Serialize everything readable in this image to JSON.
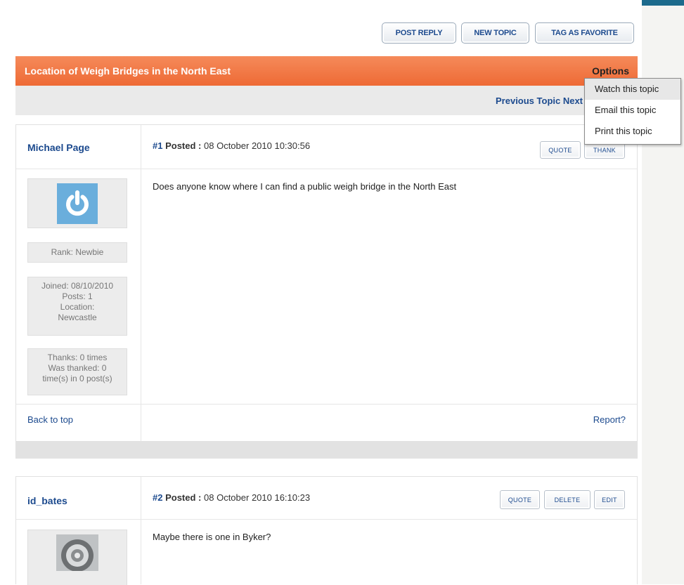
{
  "toolbar": {
    "post_reply": "POST REPLY",
    "new_topic": "NEW TOPIC",
    "tag_favorite": "TAG AS FAVORITE"
  },
  "topic": {
    "title": "Location of Weigh Bridges in the North East",
    "options_label": "Options",
    "prev_next": "Previous Topic Next Topic"
  },
  "options_menu": [
    "Watch this topic",
    "Email this topic",
    "Print this topic"
  ],
  "posts": [
    {
      "author": "Michael Page",
      "number": "#1",
      "posted_label": "Posted :",
      "date": "08 October 2010 10:30:56",
      "message": "Does anyone know where I can find a public weigh bridge in the North East",
      "rank": "Rank: Newbie",
      "joined": "Joined: 08/10/2010",
      "posts": "Posts: 1",
      "location_label": "Location:",
      "location": "Newcastle",
      "thanks": "Thanks: 0 times",
      "was_thanked": "Was thanked: 0",
      "thanked_posts": "time(s) in 0 post(s)",
      "quote": "QUOTE",
      "thank": "THANK",
      "back_to_top": "Back to top",
      "report": "Report?"
    },
    {
      "author": "id_bates",
      "number": "#2",
      "posted_label": "Posted :",
      "date": "08 October 2010 16:10:23",
      "message": "Maybe there is one in Byker?",
      "quote": "QUOTE",
      "delete": "DELETE",
      "edit": "EDIT"
    }
  ],
  "colors": {
    "title_bar": "#ee6a35",
    "link": "#1c4a8e",
    "accent": "#1c6a8c"
  }
}
